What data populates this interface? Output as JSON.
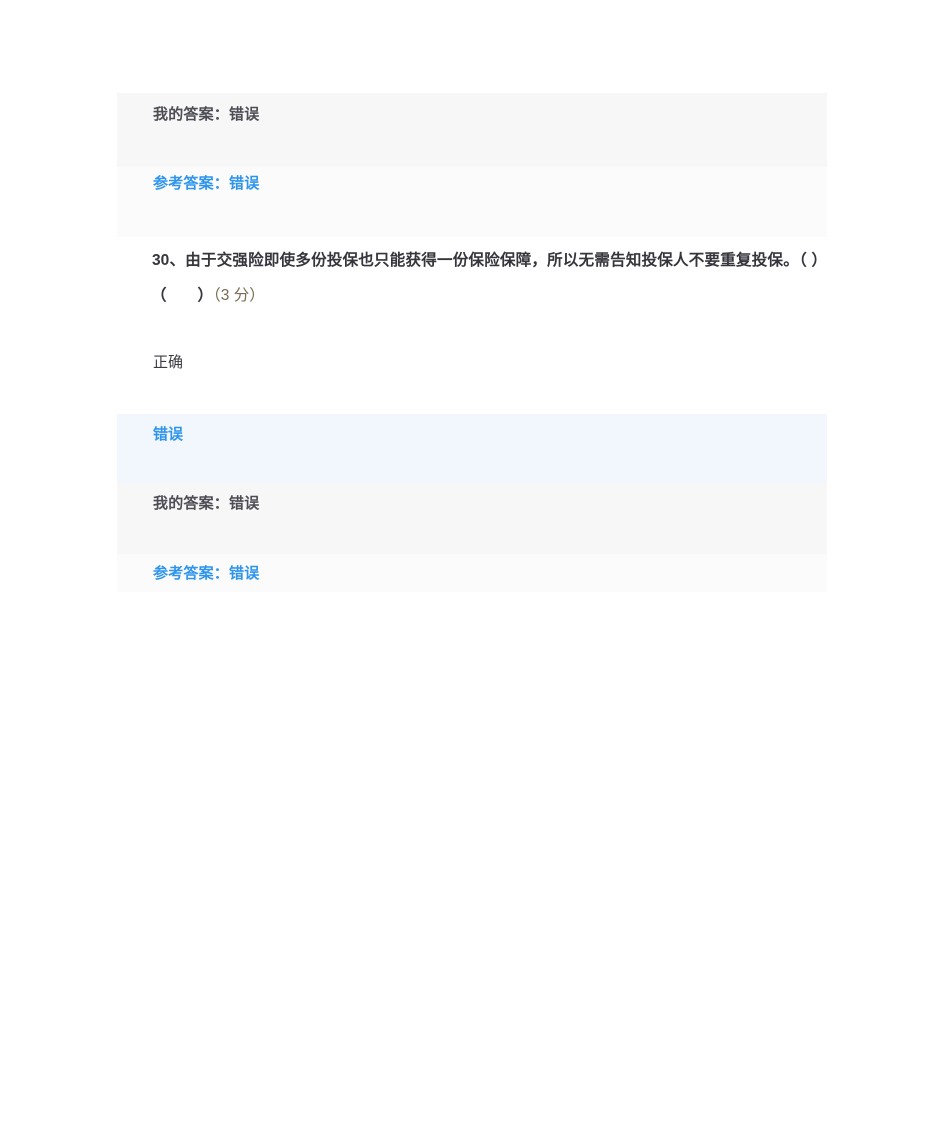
{
  "exam_review": {
    "previous_question_result": {
      "my_answer_row": {
        "label": "我的答案：",
        "value": "错误",
        "full_text": "我的答案：错误",
        "background_color": "#f7f7f7",
        "text_color": "#4d4d55"
      },
      "reference_answer_row": {
        "label": "参考答案：",
        "value": "错误",
        "full_text": "参考答案：错误",
        "background_color": "#fbfbfb",
        "text_color": "#2f95ec"
      }
    },
    "current_question": {
      "number": "30、",
      "stem": "由于交强险即使多份投保也只能获得一份保险保障，所以无需告知投保人不要重复投保。",
      "blank_marker_1": "（ ）",
      "blank_marker_2": "（　　）",
      "score_label": "（3 分）",
      "full_text": "30、由于交强险即使多份投保也只能获得一份保险保障，所以无需告知投保人不要重复投保。（ ）　（　　）（3 分）",
      "options": [
        {
          "label": "正确",
          "selected": false,
          "background_color": "#ffffff",
          "text_color": "#3c3c42"
        },
        {
          "label": "错误",
          "selected": true,
          "background_color": "#f2f6fd",
          "text_color": "#2f95ec"
        }
      ],
      "my_answer_row": {
        "label": "我的答案：",
        "value": "错误",
        "full_text": "我的答案：错误",
        "background_color": "#f7f7f7",
        "text_color": "#4d4d55"
      },
      "reference_answer_row": {
        "label": "参考答案：",
        "value": "错误",
        "full_text": "参考答案：错误",
        "background_color": "#fbfbfb",
        "text_color": "#2f95ec"
      }
    }
  }
}
